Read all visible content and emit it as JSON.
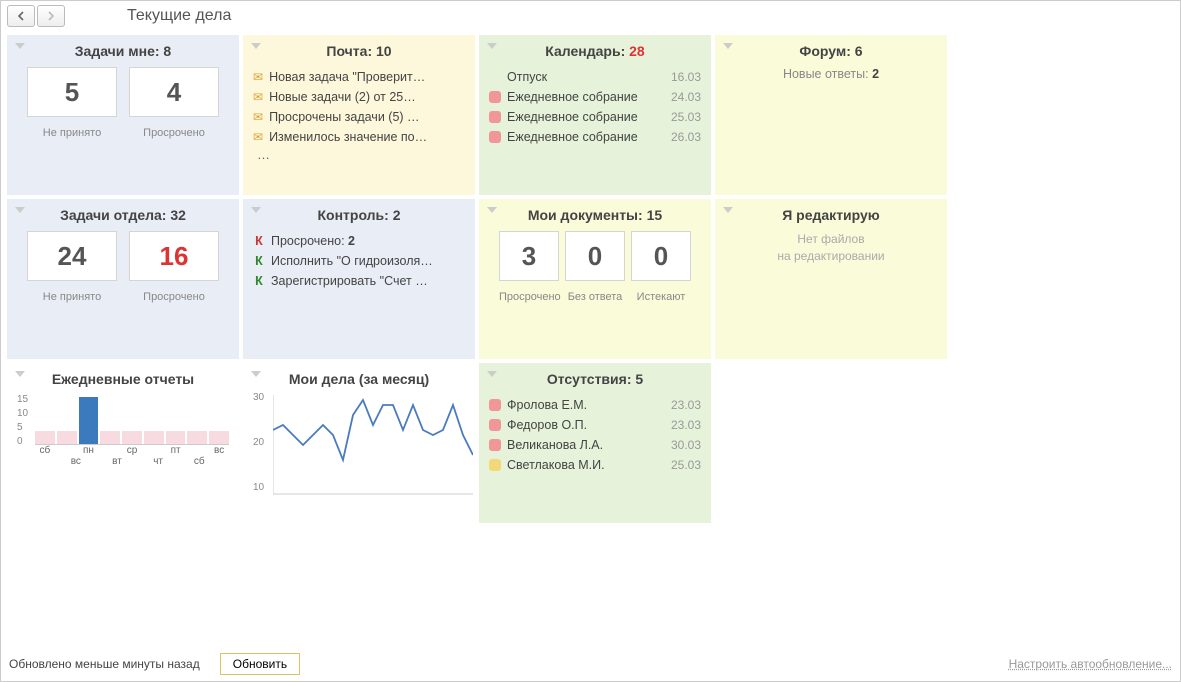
{
  "page_title": "Текущие дела",
  "cards": {
    "my_tasks": {
      "title_prefix": "Задачи мне: ",
      "count": "8",
      "box1": "5",
      "box2": "4",
      "label1": "Не принято",
      "label2": "Просрочено"
    },
    "mail": {
      "title_prefix": "Почта: ",
      "count": "10",
      "items": [
        "Новая задача \"Проверит…",
        "Новые задачи (2) от 25…",
        "Просрочены задачи (5) …",
        "Изменилось значение по…"
      ],
      "more": "…"
    },
    "calendar": {
      "title_prefix": "Календарь: ",
      "count": "28",
      "items": [
        {
          "text": "Отпуск",
          "date": "16.03",
          "dot": ""
        },
        {
          "text": "Ежедневное собрание",
          "date": "24.03",
          "dot": "red"
        },
        {
          "text": "Ежедневное собрание",
          "date": "25.03",
          "dot": "red"
        },
        {
          "text": "Ежедневное собрание",
          "date": "26.03",
          "dot": "red"
        }
      ]
    },
    "forum": {
      "title_prefix": "Форум: ",
      "count": "6",
      "line_prefix": "Новые ответы: ",
      "line_value": "2"
    },
    "dept_tasks": {
      "title_prefix": "Задачи отдела: ",
      "count": "32",
      "box1": "24",
      "box2": "16",
      "label1": "Не принято",
      "label2": "Просрочено"
    },
    "control": {
      "title_prefix": "Контроль: ",
      "count": "2",
      "items": [
        {
          "k": "К",
          "kclass": "k-red",
          "text_prefix": "Просрочено: ",
          "text_bold": "2"
        },
        {
          "k": "К",
          "kclass": "k-green",
          "text": "Исполнить \"О гидроизоля…"
        },
        {
          "k": "К",
          "kclass": "k-green",
          "text": "Зарегистрировать \"Счет …"
        }
      ]
    },
    "my_docs": {
      "title_prefix": "Мои документы: ",
      "count": "15",
      "box1": "3",
      "box2": "0",
      "box3": "0",
      "label1": "Просрочено",
      "label2": "Без ответа",
      "label3": "Истекают"
    },
    "editing": {
      "title": "Я редактирую",
      "note1": "Нет файлов",
      "note2": "на редактировании"
    },
    "daily_reports": {
      "title": "Ежедневные отчеты"
    },
    "my_matters": {
      "title": "Мои дела (за месяц)"
    },
    "absence": {
      "title_prefix": "Отсутствия: ",
      "count": "5",
      "items": [
        {
          "dot": "red",
          "text": "Фролова Е.М.",
          "date": "23.03"
        },
        {
          "dot": "red",
          "text": "Федоров О.П.",
          "date": "23.03"
        },
        {
          "dot": "red",
          "text": "Великанова Л.А.",
          "date": "30.03"
        },
        {
          "dot": "yellow",
          "text": "Светлакова М.И.",
          "date": "25.03"
        }
      ]
    }
  },
  "footer": {
    "status": "Обновлено меньше минуты назад",
    "refresh": "Обновить",
    "settings": "Настроить автообновление..."
  },
  "chart_data": [
    {
      "type": "bar",
      "title": "Ежедневные отчеты",
      "categories": [
        "сб",
        "вс",
        "пн",
        "вт",
        "ср",
        "чт",
        "пт",
        "сб",
        "вс"
      ],
      "values": [
        4,
        4,
        14,
        4,
        4,
        4,
        4,
        4,
        4
      ],
      "highlight_index": 2,
      "ylim": [
        0,
        15
      ],
      "yticks": [
        0,
        5,
        10,
        15
      ]
    },
    {
      "type": "line",
      "title": "Мои дела (за месяц)",
      "x": [
        0,
        1,
        2,
        3,
        4,
        5,
        6,
        7,
        8,
        9,
        10,
        11,
        12,
        13,
        14,
        15,
        16,
        17,
        18,
        19,
        20
      ],
      "values": [
        23,
        24,
        22,
        20,
        22,
        24,
        22,
        17,
        26,
        29,
        24,
        28,
        28,
        23,
        28,
        23,
        22,
        23,
        28,
        22,
        18
      ],
      "ylim": [
        10,
        30
      ],
      "yticks": [
        10,
        20,
        30
      ]
    }
  ]
}
